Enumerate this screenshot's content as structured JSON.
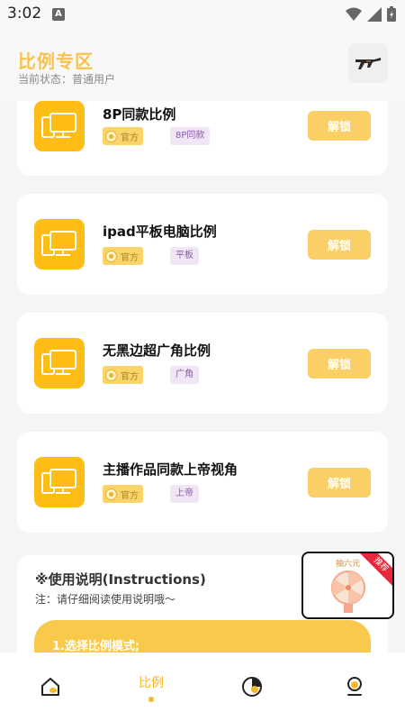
{
  "status_bar": {
    "time": "3:02",
    "notification_letter": "A"
  },
  "header": {
    "title": "比例专区",
    "subtitle": "当前状态：普通用户",
    "action_icon": "gun-icon"
  },
  "cards": [
    {
      "title": "8P同款比例",
      "official_tag": "官方",
      "category_tag": "8P同款",
      "action_label": "解锁"
    },
    {
      "title": "ipad平板电脑比例",
      "official_tag": "官方",
      "category_tag": "平板",
      "action_label": "解锁"
    },
    {
      "title": "无黑边超广角比例",
      "official_tag": "官方",
      "category_tag": "广角",
      "action_label": "解锁"
    },
    {
      "title": "主播作品同款上帝视角",
      "official_tag": "官方",
      "category_tag": "上帝",
      "action_label": "解锁"
    }
  ],
  "instructions": {
    "title": "※使用说明(Instructions)",
    "note": "注：请仔细阅读使用说明哦～",
    "step1": "1.选择比例模式;"
  },
  "promo": {
    "label": "抽六元",
    "ribbon": "推荐"
  },
  "bottom_nav": [
    {
      "icon": "home-icon",
      "label": ""
    },
    {
      "icon": "ratio-icon",
      "label": "比例",
      "active": true
    },
    {
      "icon": "pie-chart-icon",
      "label": ""
    },
    {
      "icon": "profile-icon",
      "label": ""
    }
  ],
  "colors": {
    "accent": "#f6c44e",
    "icon_bg": "#ffbd15",
    "unlock": "#f9cf66",
    "tag_purple": "#8b5ca8"
  }
}
